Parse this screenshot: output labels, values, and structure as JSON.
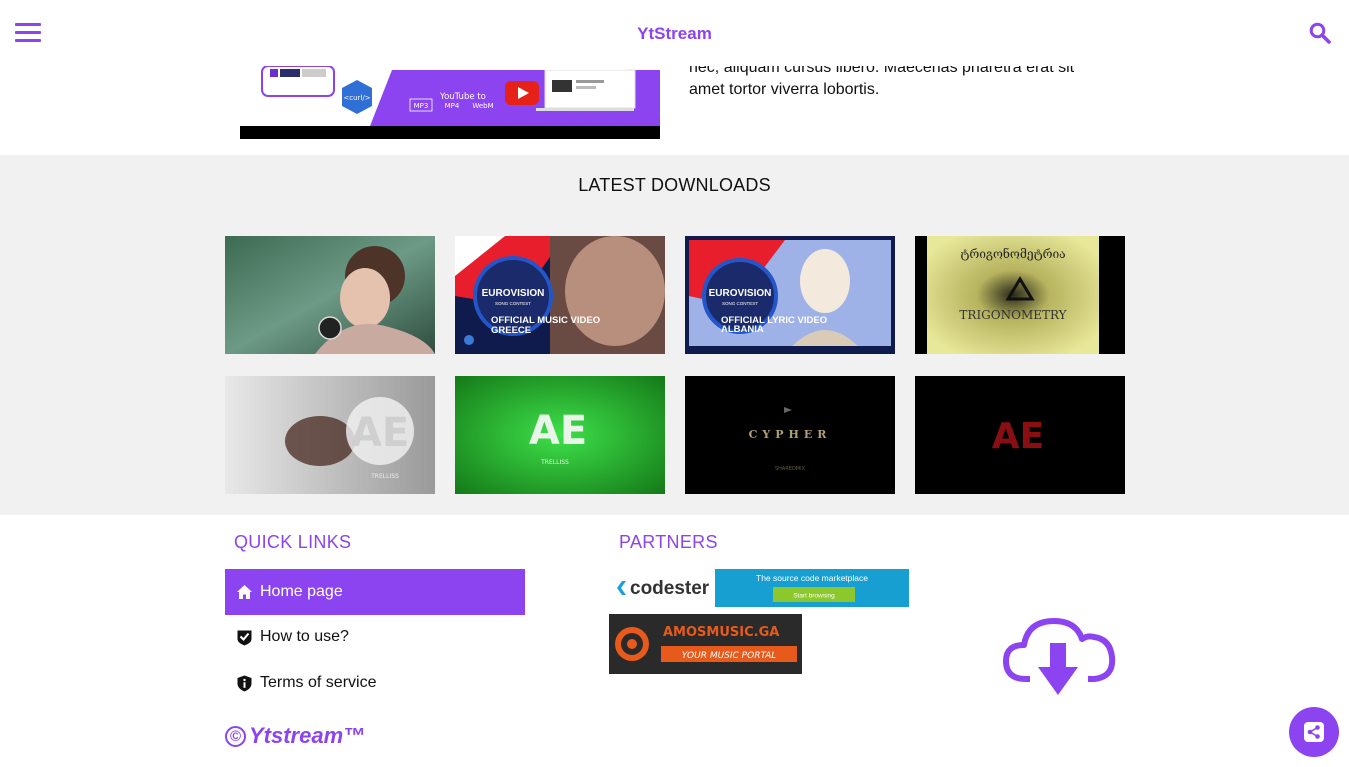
{
  "header": {
    "brand": "YtStream",
    "menu_icon": "hamburger-menu-icon",
    "search_icon": "search-icon"
  },
  "hero": {
    "image": {
      "badge_text": "<curl/>",
      "formats": [
        "MP3",
        "MP4",
        "WebM"
      ],
      "caption": "YouTube to"
    },
    "text_line1": "nec, aliquam cursus libero. Maecenas pharetra erat sit",
    "text_line2": "amet tortor viverra lobortis."
  },
  "downloads": {
    "title": "LATEST DOWNLOADS",
    "thumbs": [
      {
        "caption": ""
      },
      {
        "caption": "OFFICIAL MUSIC VIDEO",
        "sub": "GREECE",
        "logo": "EUROVISION",
        "logo_sub": "SONG CONTEST"
      },
      {
        "caption": "OFFICIAL LYRIC VIDEO",
        "sub": "ALBANIA",
        "logo": "EUROVISION",
        "logo_sub": "SONG CONTEST"
      },
      {
        "caption": "TRIGONOMETRY",
        "sub": "ტრიგონომეტრია"
      },
      {
        "caption": "TRELLISS"
      },
      {
        "caption": "TRELLISS"
      },
      {
        "caption": "CYPHER",
        "sub": "SHAREDMIX"
      },
      {
        "caption": ""
      }
    ]
  },
  "footer": {
    "quick_links_title": "QUICK LINKS",
    "quick_links": [
      {
        "label": "Home page",
        "icon": "home-icon"
      },
      {
        "label": "How to use?",
        "icon": "shield-check-icon"
      },
      {
        "label": "Terms of service",
        "icon": "shield-info-icon"
      }
    ],
    "partners_title": "PARTNERS",
    "partner1": {
      "brand": "codester",
      "tagline": "The source code marketplace",
      "cta": "Start browsing"
    },
    "partner2": {
      "brand": "AMOSMUSIC.GA",
      "tagline": "YOUR MUSIC PORTAL"
    },
    "copyright_symbol": "©",
    "copyright": "Ytstream™",
    "cloud_icon": "cloud-download-icon",
    "share_icon": "share-icon"
  },
  "colors": {
    "accent": "#8b44f0",
    "downloads_bg": "#f1f1f1"
  }
}
